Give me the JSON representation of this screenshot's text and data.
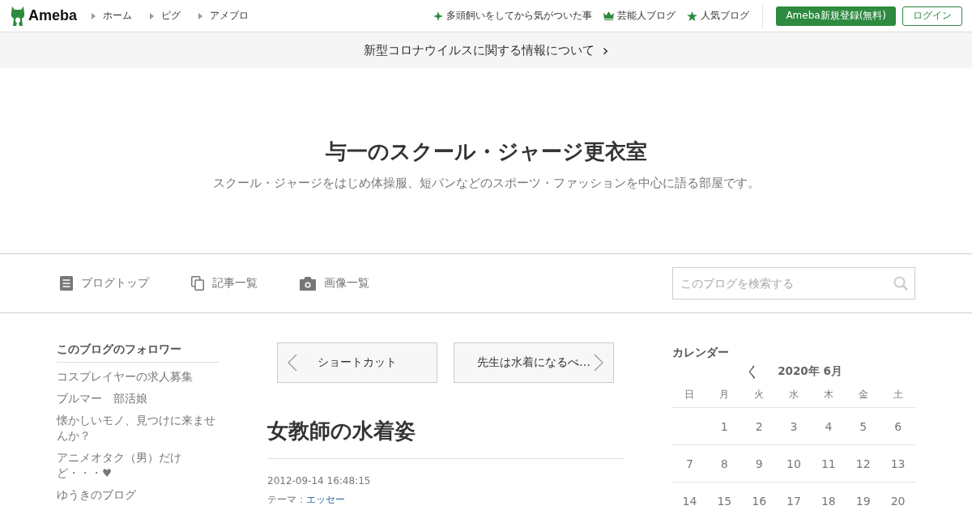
{
  "header": {
    "logo": "Ameba",
    "nav": [
      "ホーム",
      "ピグ",
      "アメブロ"
    ],
    "links": [
      {
        "kind": "sparkle",
        "label": "多頭飼いをしてから気がついた事"
      },
      {
        "kind": "crown",
        "label": "芸能人ブログ"
      },
      {
        "kind": "star",
        "label": "人気ブログ"
      }
    ],
    "register_button": "Ameba新規登録(無料)",
    "login_button": "ログイン"
  },
  "notice": {
    "text": "新型コロナウイルスに関する情報について",
    "arrow": "›"
  },
  "blog": {
    "title": "与一のスクール・ジャージ更衣室",
    "description": "スクール・ジャージをはじめ体操服、短パンなどのスポーツ・ファッションを中心に語る部屋です。"
  },
  "blog_nav": [
    {
      "kind": "top",
      "label": "ブログトップ"
    },
    {
      "kind": "entries",
      "label": "記事一覧"
    },
    {
      "kind": "images",
      "label": "画像一覧"
    }
  ],
  "search": {
    "placeholder": "このブログを検索する"
  },
  "followers": {
    "title": "このブログのフォロワー",
    "items": [
      "コスプレイヤーの求人募集",
      "ブルマー　部活娘",
      "懐かしいモノ、見つけに来ませんか？",
      "アニメオタク（男）だけど・・・♥",
      "ゆうきのブログ"
    ]
  },
  "pager": {
    "prev": "ショートカット",
    "next": "先生は水着になるべ…"
  },
  "article": {
    "title": "女教師の水着姿",
    "date": "2012-09-14 16:48:15",
    "theme_label": "テーマ：",
    "theme": "エッセー"
  },
  "calendar": {
    "title": "カレンダー",
    "prev": "く",
    "month": "2020年 6月",
    "weekdays": [
      "日",
      "月",
      "火",
      "水",
      "木",
      "金",
      "土"
    ],
    "weeks": [
      [
        {
          "kind": "empty"
        },
        {
          "kind": "day",
          "label": "1"
        },
        {
          "kind": "day",
          "label": "2"
        },
        {
          "kind": "day",
          "label": "3"
        },
        {
          "kind": "day",
          "label": "4"
        },
        {
          "kind": "day",
          "label": "5"
        },
        {
          "kind": "day",
          "label": "6"
        }
      ],
      [
        {
          "kind": "day",
          "label": "7"
        },
        {
          "kind": "day",
          "label": "8"
        },
        {
          "kind": "day",
          "label": "9"
        },
        {
          "kind": "day",
          "label": "10"
        },
        {
          "kind": "day",
          "label": "11"
        },
        {
          "kind": "day",
          "label": "12"
        },
        {
          "kind": "day",
          "label": "13"
        }
      ],
      [
        {
          "kind": "day",
          "label": "14"
        },
        {
          "kind": "day",
          "label": "15"
        },
        {
          "kind": "day",
          "label": "16"
        },
        {
          "kind": "day",
          "label": "17"
        },
        {
          "kind": "day",
          "label": "18"
        },
        {
          "kind": "day",
          "label": "19"
        },
        {
          "kind": "day",
          "label": "20"
        }
      ]
    ]
  }
}
